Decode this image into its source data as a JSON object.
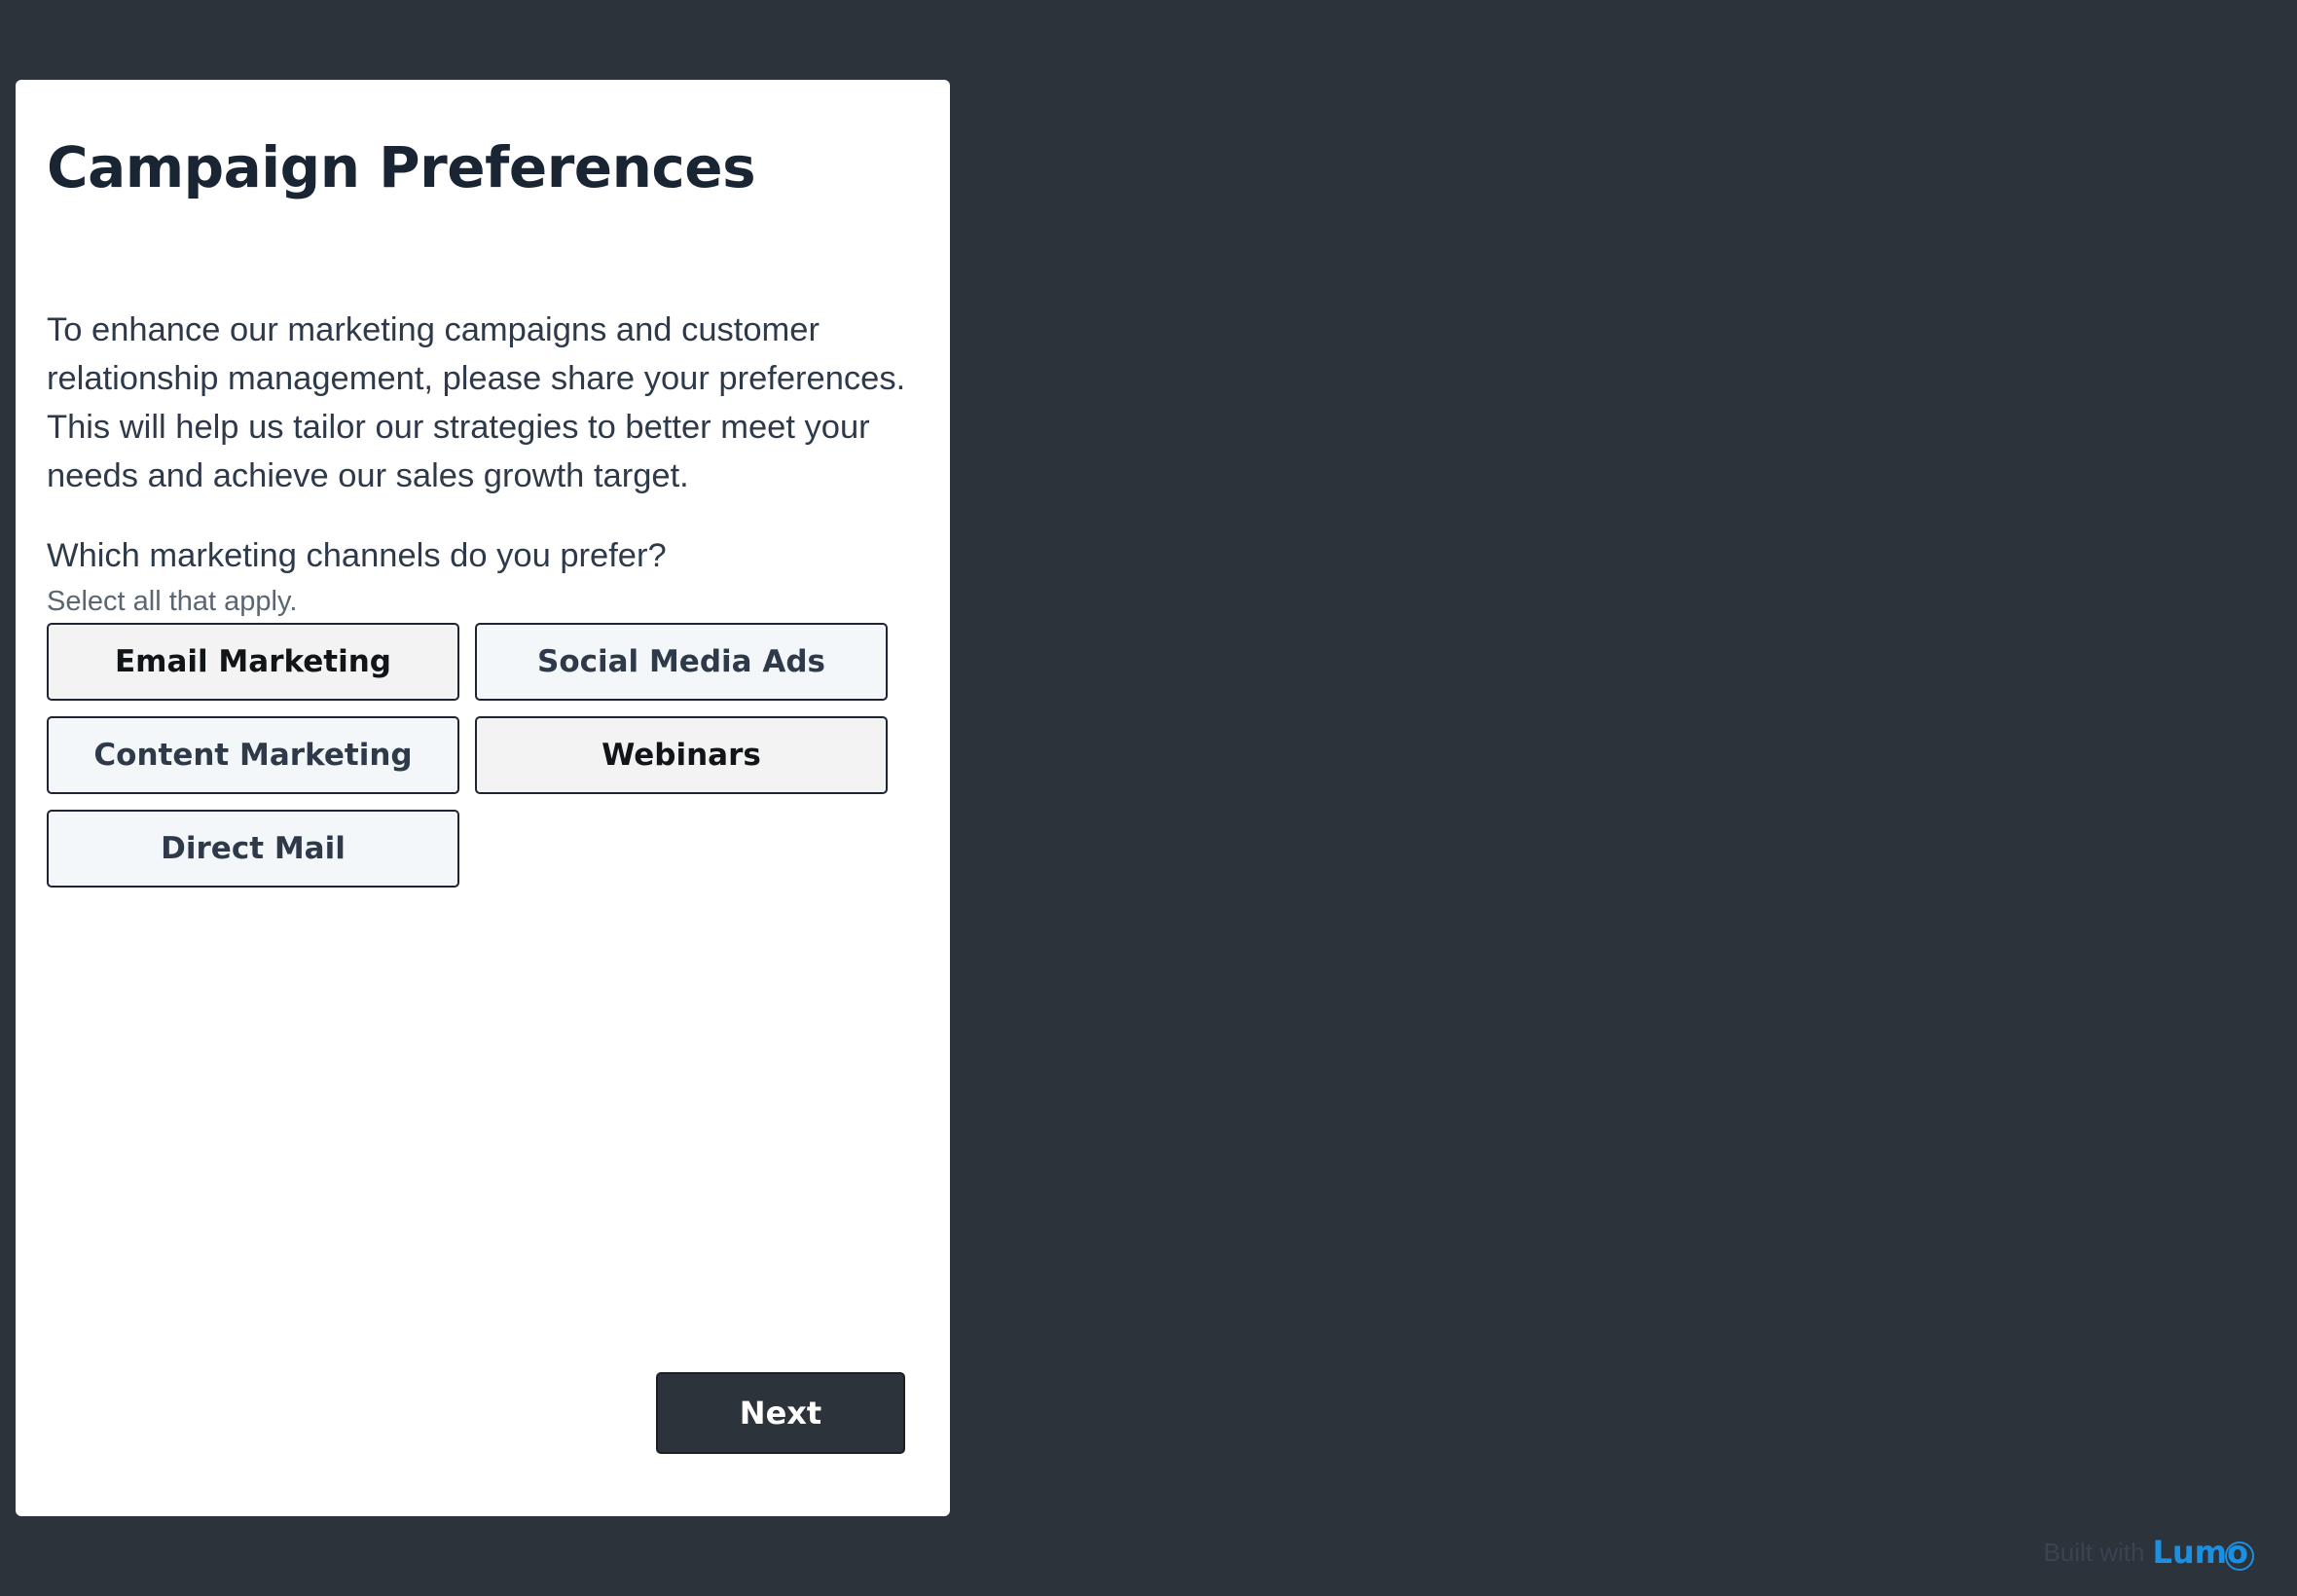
{
  "card": {
    "title": "Campaign Preferences",
    "intro": "To enhance our marketing campaigns and customer relationship management, please share your preferences. This will help us tailor our strategies to better meet your needs and achieve our sales growth target.",
    "question": "Which marketing channels do you prefer?",
    "hint": "Select all that apply.",
    "options": [
      {
        "label": "Email Marketing",
        "selected": true
      },
      {
        "label": "Social Media Ads",
        "selected": false
      },
      {
        "label": "Content Marketing",
        "selected": false
      },
      {
        "label": "Webinars",
        "selected": true
      },
      {
        "label": "Direct Mail",
        "selected": false
      }
    ],
    "next_label": "Next"
  },
  "branding": {
    "built_with": "Built with",
    "brand": "Lumo"
  },
  "colors": {
    "background": "#2c333b",
    "card": "#ffffff",
    "accent": "#1d8fe0",
    "selected_option_bg": "#f3f3f3",
    "unselected_option_bg": "#f4f7f9"
  }
}
